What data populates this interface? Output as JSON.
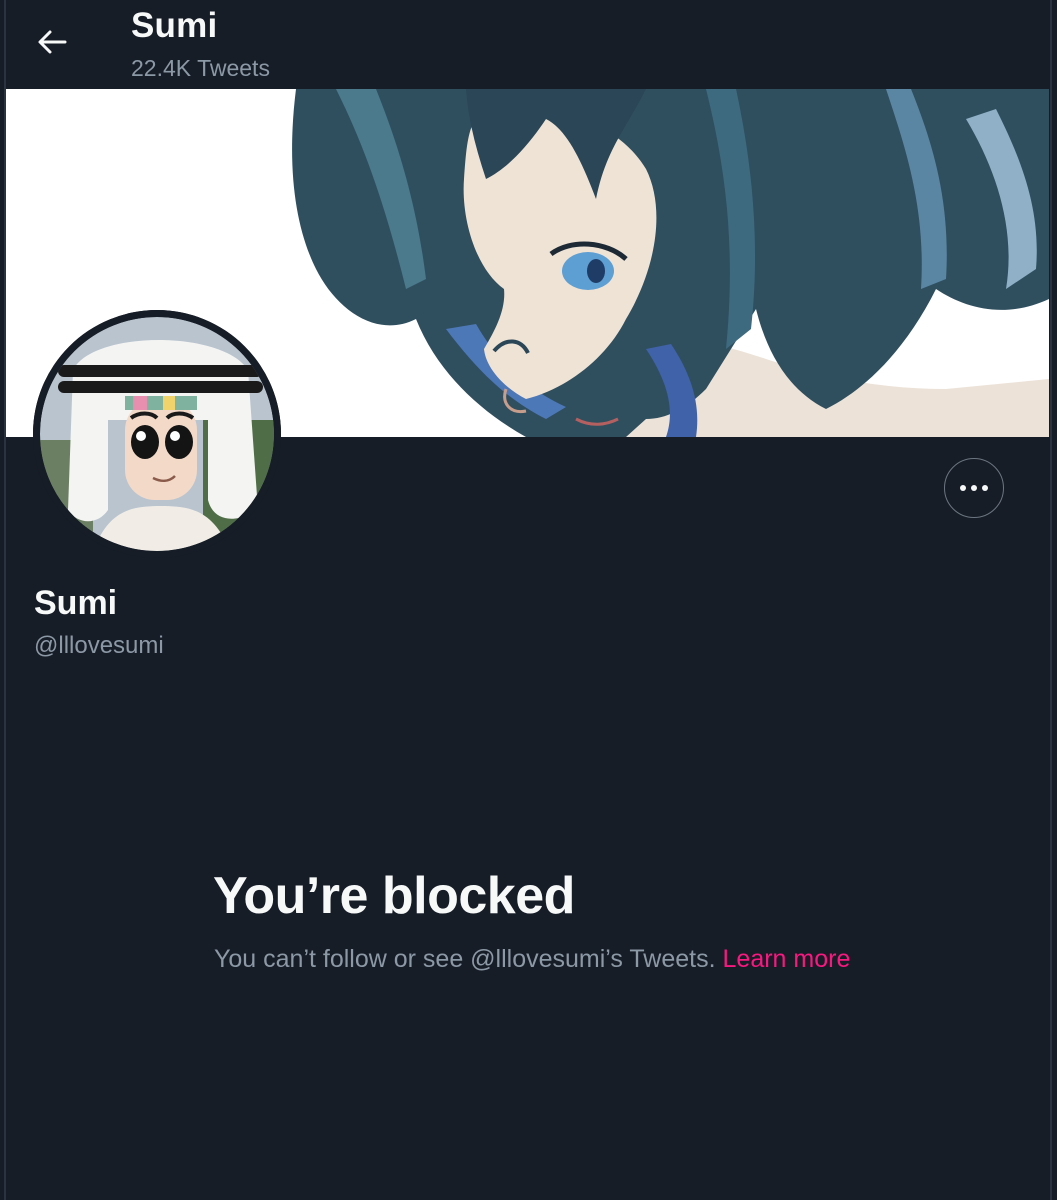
{
  "header": {
    "title": "Sumi",
    "subtitle": "22.4K Tweets"
  },
  "profile": {
    "display_name": "Sumi",
    "handle": "@lllovesumi"
  },
  "blocked": {
    "title": "You’re blocked",
    "message": "You can’t follow or see @lllovesumi’s Tweets.",
    "link_label": "Learn more"
  },
  "icons": {
    "back": "arrow-left-icon",
    "more": "more-horizontal-icon"
  },
  "colors": {
    "background": "#171d27",
    "primary_text": "#f7f9f9",
    "secondary_text": "#8b98a5",
    "link": "#f91880"
  }
}
